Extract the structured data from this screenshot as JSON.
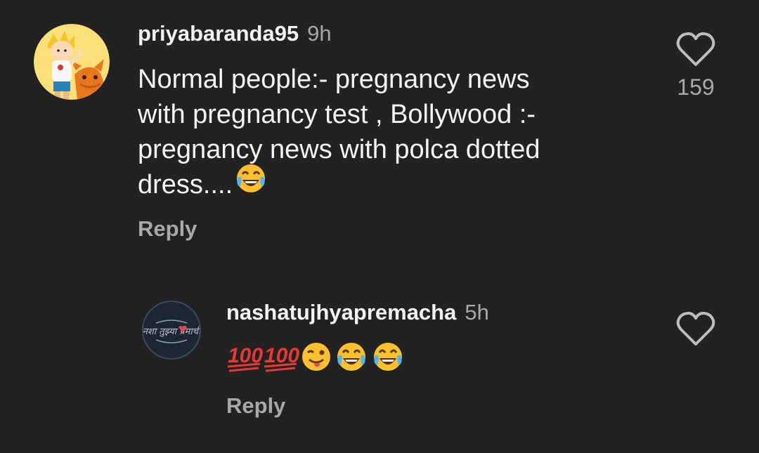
{
  "comments": [
    {
      "username": "priyabaranda95",
      "time": "9h",
      "text": "Normal people:- pregnancy news\nwith pregnancy test , Bollywood :-\npregnancy news with polca dotted\ndress....",
      "reply_label": "Reply",
      "likes": "159",
      "avatar": "cartoon-boy-and-fox-avatar"
    },
    {
      "username": "nashatujhyapremacha",
      "time": "5h",
      "text_emojis": [
        "hundred-points-emoji",
        "hundred-points-emoji",
        "winking-face-with-tongue-emoji",
        "tears-of-joy-emoji",
        "tears-of-joy-emoji"
      ],
      "reply_label": "Reply",
      "avatar": "marathi-calligraphy-avatar",
      "avatar_text": "नशा तुझ्या प्रेमाची"
    }
  ],
  "colors": {
    "background": "#232223",
    "text": "#f4f4f4",
    "muted": "#a8a8a8"
  }
}
